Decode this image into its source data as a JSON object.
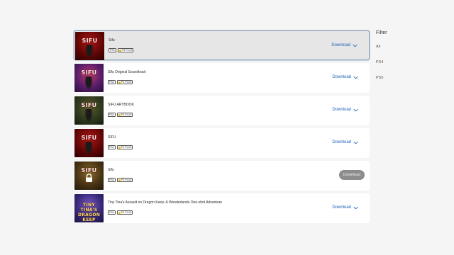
{
  "items": [
    {
      "title": "Sifu",
      "logo": "SIFU",
      "platform": "PS4",
      "plus": "PS PLUS",
      "action": "Download",
      "state": "selected"
    },
    {
      "title": "Sifu Original Soundtrack",
      "logo": "SIFU",
      "platform": "PS4",
      "plus": "PS PLUS",
      "action": "Download",
      "state": "normal"
    },
    {
      "title": "SIFU ARTBOOK",
      "logo": "SIFU",
      "platform": "PS4",
      "plus": "PS PLUS",
      "action": "Download",
      "state": "normal"
    },
    {
      "title": "SIFU",
      "logo": "SIFU",
      "platform": "PS4",
      "plus": "PS PLUS",
      "action": "Download",
      "state": "normal"
    },
    {
      "title": "Sifu",
      "logo": "SIFU",
      "platform": "PS4",
      "plus": "PS PLUS",
      "action": "Download",
      "state": "locked"
    },
    {
      "title": "Tiny Tina's Assault on Dragon Keep: A Wonderlands One-shot Adventure",
      "logo": "TINY TINA'S DRAGON KEEP",
      "platform": "PS4",
      "plus": "PS PLUS",
      "action": "Download",
      "state": "normal"
    }
  ],
  "filter": {
    "title": "Filter",
    "options": [
      "All",
      "PS4",
      "PS5"
    ]
  },
  "colors": {
    "accent": "#1a62b8",
    "disabled_button": "#8c8c8c",
    "selected_row": "#e6e6e6"
  }
}
